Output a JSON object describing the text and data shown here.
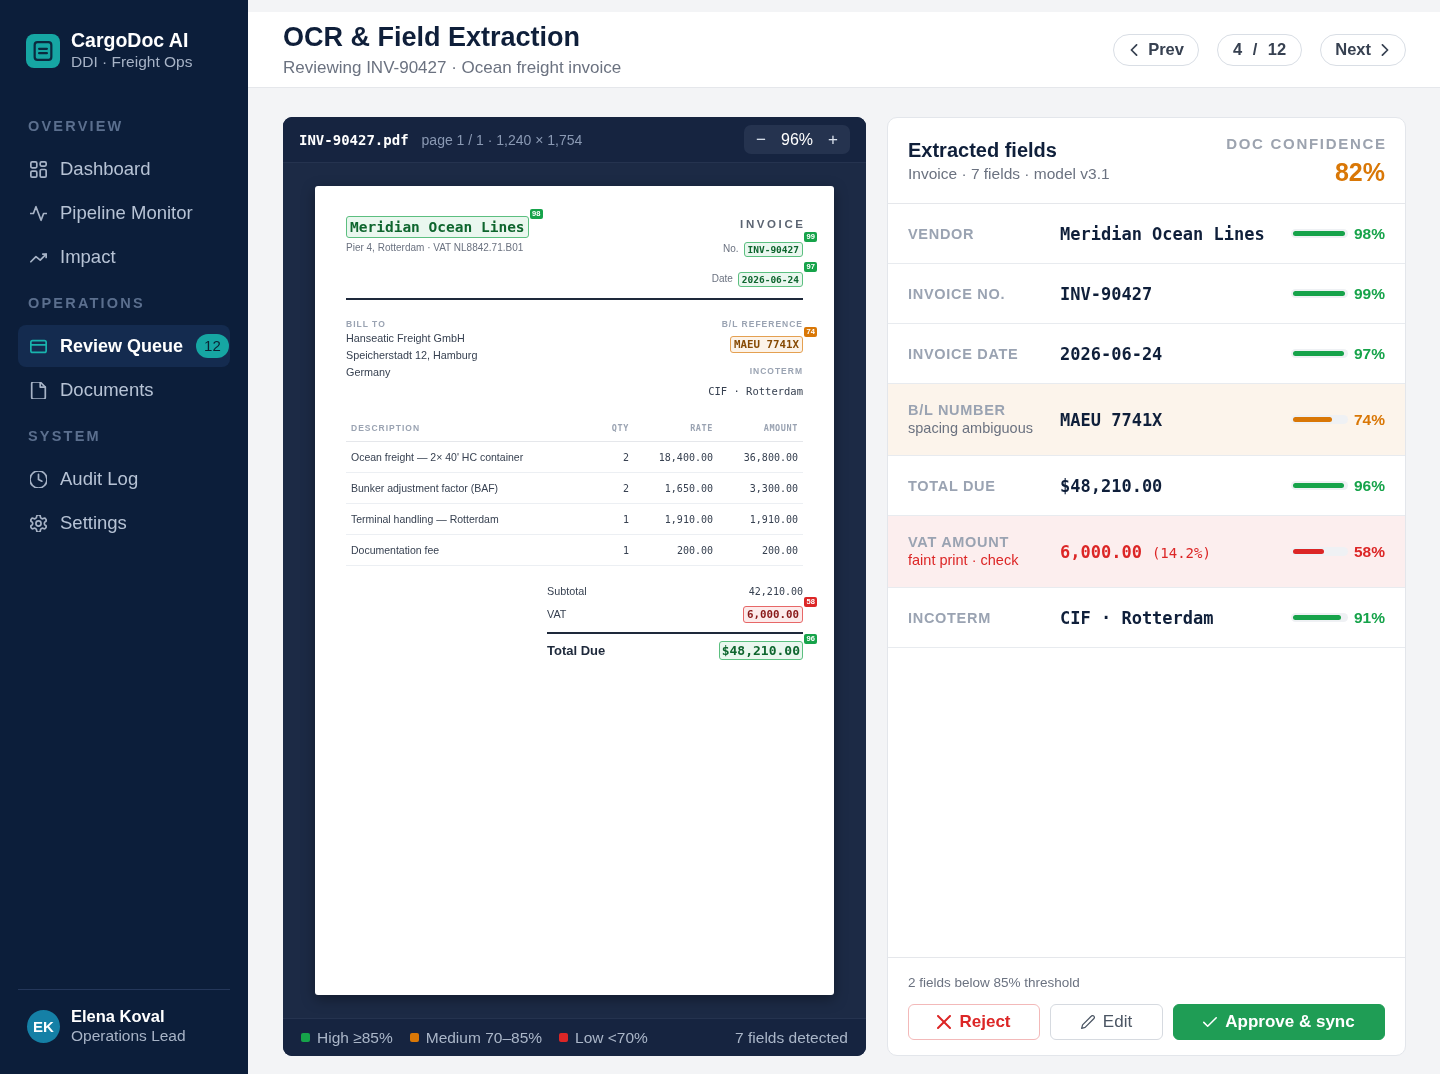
{
  "sidebar": {
    "brand": {
      "name": "CargoDoc AI",
      "subtitle": "DDI · Freight Ops"
    },
    "sections": [
      {
        "title": "OVERVIEW",
        "items": [
          {
            "label": "Dashboard",
            "selected": false
          },
          {
            "label": "Pipeline Monitor",
            "selected": false
          },
          {
            "label": "Impact",
            "selected": false
          }
        ]
      },
      {
        "title": "OPERATIONS",
        "items": [
          {
            "label": "Review Queue",
            "selected": true,
            "badge": "12"
          },
          {
            "label": "Documents",
            "selected": false
          }
        ]
      },
      {
        "title": "SYSTEM",
        "items": [
          {
            "label": "Audit Log",
            "selected": false
          },
          {
            "label": "Settings",
            "selected": false
          }
        ]
      }
    ],
    "user": {
      "initials": "EK",
      "name": "Elena Koval",
      "role": "Operations Lead"
    }
  },
  "header": {
    "title": "OCR & Field Extraction",
    "subtitle": "Reviewing INV-90427 · Ocean freight invoice",
    "prev": "Prev",
    "position": "4 / 12",
    "next": "Next"
  },
  "document": {
    "filename": "INV-90427.pdf",
    "page_info": "page 1 / 1 · 1,240 × 1,754",
    "zoom": {
      "out": "−",
      "level": "96%",
      "in": "+"
    },
    "invoice": {
      "vendor": {
        "value": "Meridian Ocean Lines",
        "score": "98",
        "color": "#16a34a"
      },
      "vendor_address": "Pier 4, Rotterdam · VAT NL8842.71.B01",
      "doc_type": "INVOICE",
      "meta_fields": [
        {
          "label": "No.",
          "value": "INV-90427",
          "score": "99",
          "color": "#16a34a"
        },
        {
          "label": "Date",
          "value": "2026-06-24",
          "score": "97",
          "color": "#16a34a"
        }
      ],
      "bill_to": {
        "label": "BILL TO",
        "lines": [
          "Hanseatic Freight GmbH",
          "Speicherstadt 12, Hamburg",
          "Germany"
        ]
      },
      "references": [
        {
          "label": "B/L REFERENCE",
          "kind": "extracted",
          "value": "MAEU 7741X",
          "score": "74",
          "color": "#d97706"
        },
        {
          "label": "INCOTERM",
          "kind": "plain",
          "value": "CIF · Rotterdam"
        }
      ],
      "table": {
        "columns": [
          {
            "label": "DESCRIPTION",
            "kind": "text"
          },
          {
            "label": "QTY",
            "kind": "number"
          },
          {
            "label": "RATE",
            "kind": "number"
          },
          {
            "label": "AMOUNT",
            "kind": "number"
          }
        ],
        "rows": [
          [
            "Ocean freight — 2× 40' HC container",
            "2",
            "18,400.00",
            "36,800.00"
          ],
          [
            "Bunker adjustment factor (BAF)",
            "2",
            "1,650.00",
            "3,300.00"
          ],
          [
            "Terminal handling — Rotterdam",
            "1",
            "1,910.00",
            "1,910.00"
          ],
          [
            "Documentation fee",
            "1",
            "200.00",
            "200.00"
          ]
        ]
      },
      "totals": [
        {
          "kind": "plain",
          "label": "Subtotal",
          "value": "42,210.00"
        },
        {
          "kind": "extracted",
          "label": "VAT",
          "value": "6,000.00",
          "score": "58",
          "color": "#dc2626"
        },
        {
          "kind": "total",
          "label": "Total Due",
          "value": "$48,210.00",
          "score": "96",
          "color": "#16a34a"
        }
      ]
    },
    "legend": [
      {
        "label": "High ≥85%",
        "color": "#16a34a"
      },
      {
        "label": "Medium 70–85%",
        "color": "#d97706"
      },
      {
        "label": "Low <70%",
        "color": "#dc2626"
      }
    ],
    "fields_detected": "7 fields detected"
  },
  "fields": {
    "title": "Extracted fields",
    "subtitle": "Invoice · 7 fields · model v3.1",
    "confidence_label": "DOC CONFIDENCE",
    "confidence": "82%",
    "items": [
      {
        "label": "VENDOR",
        "value": "Meridian Ocean Lines",
        "level": 0.98,
        "score": "98%",
        "color": "#16a34a",
        "flagged": false,
        "alert": false
      },
      {
        "label": "INVOICE NO.",
        "value": "INV-90427",
        "level": 0.99,
        "score": "99%",
        "color": "#16a34a",
        "flagged": false,
        "alert": false
      },
      {
        "label": "INVOICE DATE",
        "value": "2026-06-24",
        "level": 0.97,
        "score": "97%",
        "color": "#16a34a",
        "flagged": false,
        "alert": false
      },
      {
        "label": "B/L NUMBER",
        "note": "spacing ambiguous",
        "value": "MAEU 7741X",
        "level": 0.74,
        "score": "74%",
        "color": "#d97706",
        "flagged": true,
        "alert": false
      },
      {
        "label": "TOTAL DUE",
        "value": "$48,210.00",
        "level": 0.96,
        "score": "96%",
        "color": "#16a34a",
        "flagged": false,
        "alert": false
      },
      {
        "label": "VAT AMOUNT",
        "note": "faint print · check",
        "value": "6,000.00",
        "value_note": "(14.2%)",
        "level": 0.58,
        "score": "58%",
        "color": "#dc2626",
        "flagged": true,
        "alert": true
      },
      {
        "label": "INCOTERM",
        "value": "CIF · Rotterdam",
        "level": 0.91,
        "score": "91%",
        "color": "#16a34a",
        "flagged": false,
        "alert": false
      }
    ],
    "threshold_note": "2 fields below 85% threshold",
    "actions": [
      {
        "label": "Reject",
        "kind": "reject"
      },
      {
        "label": "Edit",
        "kind": "edit"
      },
      {
        "label": "Approve & sync",
        "kind": "approve"
      }
    ]
  }
}
